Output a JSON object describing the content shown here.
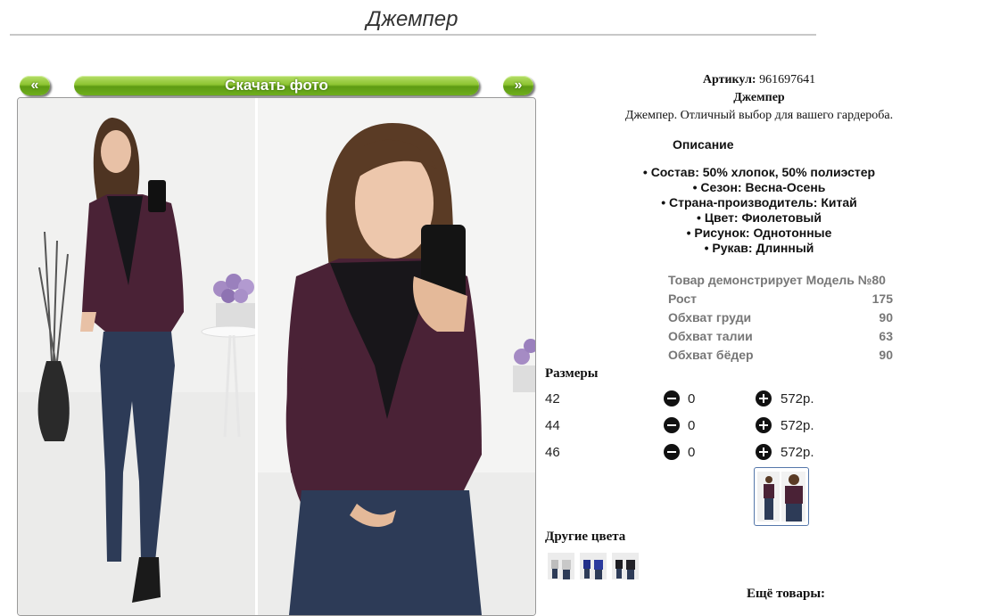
{
  "page": {
    "title": "Джемпер"
  },
  "nav": {
    "prev_label": "«",
    "download_label": "Скачать фото",
    "next_label": "»"
  },
  "product": {
    "article_label": "Артикул:",
    "article_value": "961697641",
    "name": "Джемпер",
    "tagline": "Джемпер. Отличный выбор для вашего гардероба.",
    "description_heading": "Описание",
    "properties": [
      "Состав: 50% хлопок, 50% полиэстер",
      "Сезон: Весна-Осень",
      "Страна-производитель: Китай",
      "Цвет: Фиолетовый",
      "Рисунок: Однотонные",
      "Рукав: Длинный"
    ]
  },
  "model": {
    "heading": "Товар демонстрирует Модель №80",
    "rows": [
      {
        "label": "Рост",
        "value": "175"
      },
      {
        "label": "Обхват груди",
        "value": "90"
      },
      {
        "label": "Обхват талии",
        "value": "63"
      },
      {
        "label": "Обхват бёдер",
        "value": "90"
      }
    ]
  },
  "sizes": {
    "heading": "Размеры",
    "rows": [
      {
        "size": "42",
        "qty": "0",
        "price": "572р."
      },
      {
        "size": "44",
        "qty": "0",
        "price": "572р."
      },
      {
        "size": "46",
        "qty": "0",
        "price": "572р."
      }
    ]
  },
  "other_colors": {
    "heading": "Другие цвета"
  },
  "more_products": {
    "heading": "Ещё товары:"
  },
  "colors": {
    "accent_green": "#7cb928",
    "sweater": "#4a2236",
    "jeans": "#2d3b57"
  },
  "icons": {
    "minus": "minus-circle-icon",
    "plus": "plus-circle-icon"
  }
}
